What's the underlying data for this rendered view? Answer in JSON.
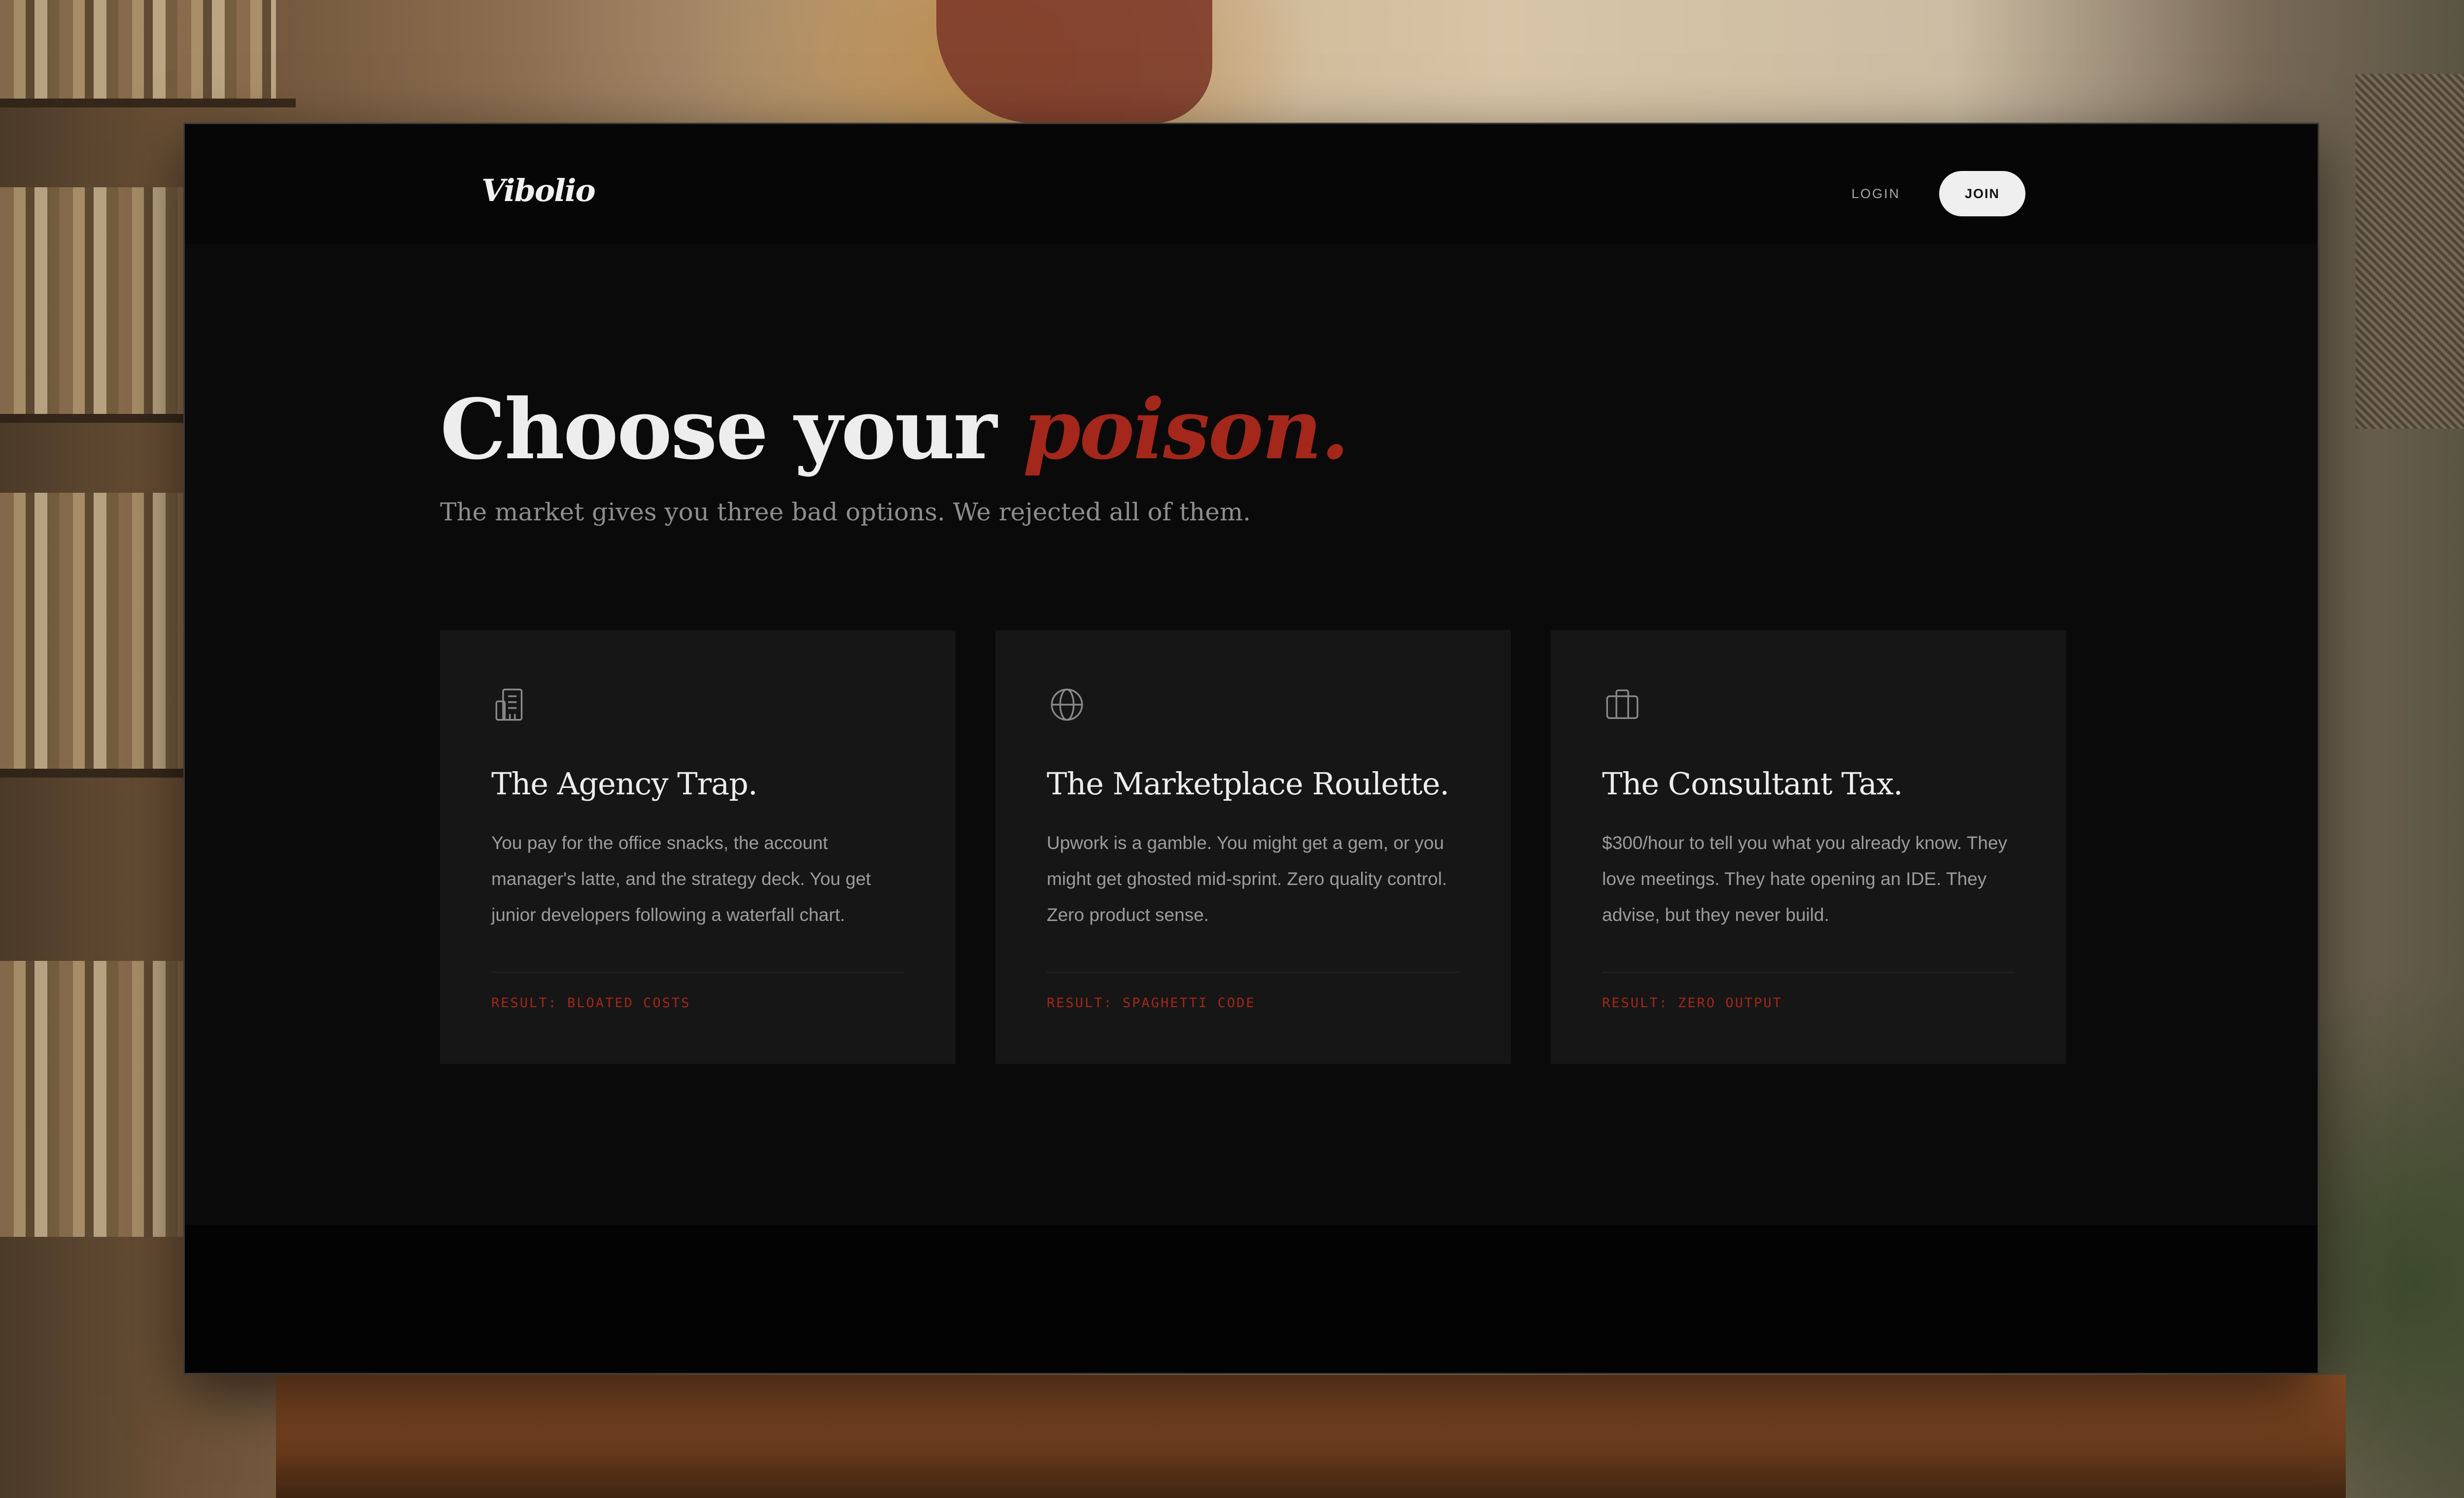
{
  "app": {
    "logo": "Vibolio"
  },
  "nav": {
    "login_label": "LOGIN",
    "join_label": "JOIN"
  },
  "hero": {
    "title_prefix": "Choose your ",
    "title_accent": "poison.",
    "subtitle": "The market gives you three bad options. We rejected all of them."
  },
  "cards": [
    {
      "icon": "office-building-icon",
      "title": "The Agency Trap.",
      "body": "You pay for the office snacks, the account manager's latte, and the strategy deck. You get junior developers following a waterfall chart.",
      "result": "RESULT: BLOATED COSTS"
    },
    {
      "icon": "globe-icon",
      "title": "The Marketplace Roulette.",
      "body": "Upwork is a gamble. You might get a gem, or you might get ghosted mid-sprint. Zero quality control. Zero product sense.",
      "result": "RESULT: SPAGHETTI CODE"
    },
    {
      "icon": "briefcase-icon",
      "title": "The Consultant Tax.",
      "body": "$300/hour to tell you what you already know. They love meetings. They hate opening an IDE. They advise, but they never build.",
      "result": "RESULT: ZERO OUTPUT"
    }
  ],
  "colors": {
    "accent": "#a3271a",
    "background": "#0a0a0a",
    "card": "#161616"
  }
}
